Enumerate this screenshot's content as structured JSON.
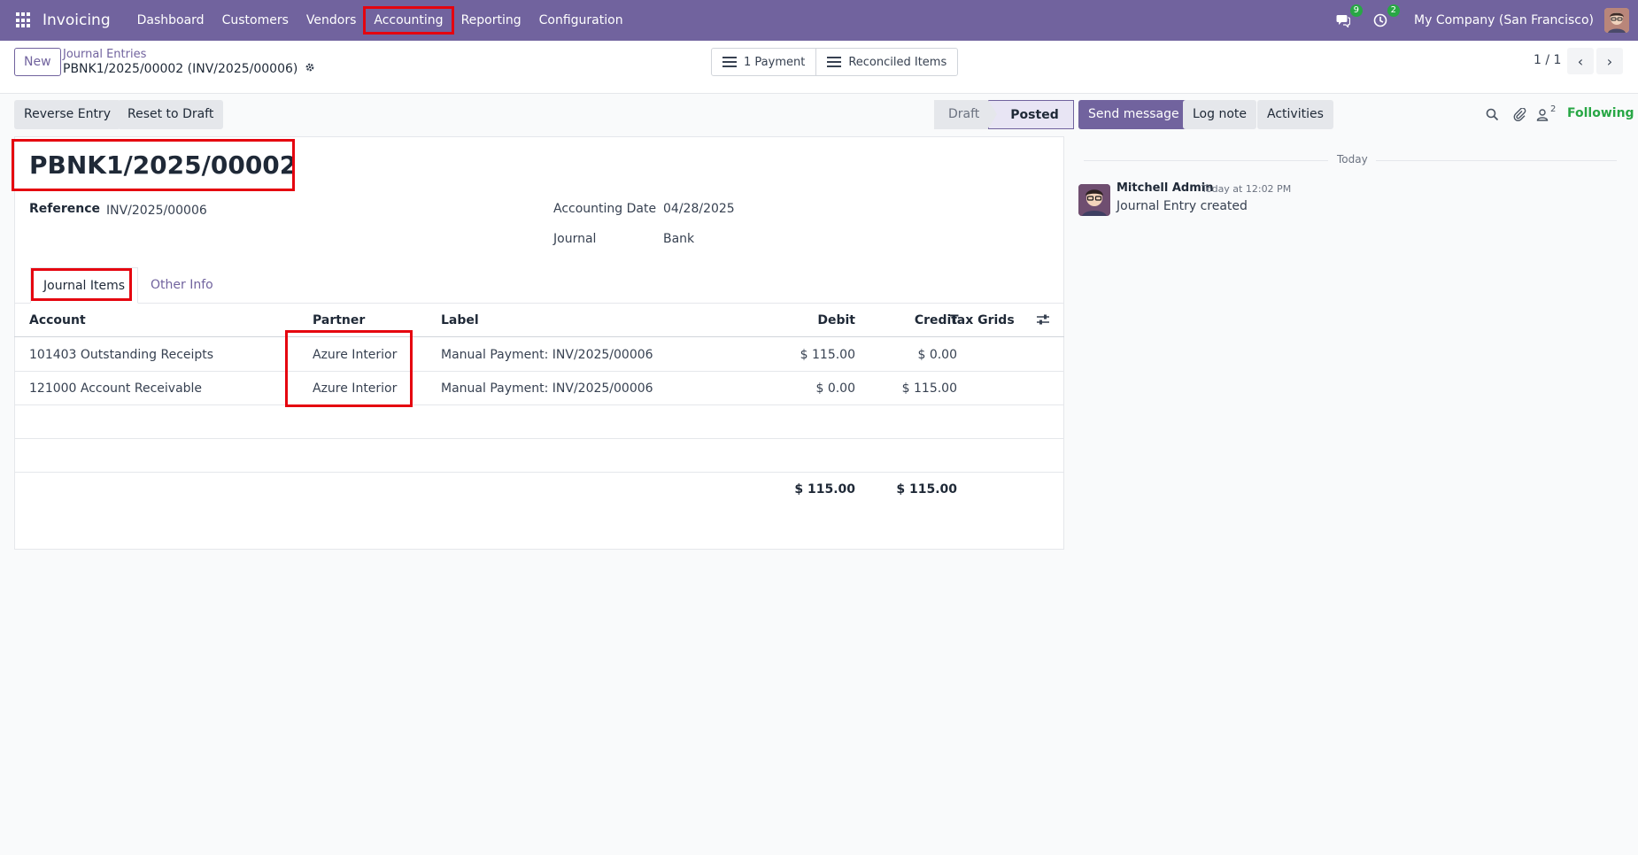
{
  "app": {
    "name": "Invoicing",
    "menu": [
      "Dashboard",
      "Customers",
      "Vendors",
      "Accounting",
      "Reporting",
      "Configuration"
    ],
    "highlighted_menu": "Accounting",
    "messages_badge": "9",
    "activities_badge": "2",
    "company": "My Company (San Francisco)"
  },
  "control_panel": {
    "new_label": "New",
    "breadcrumb_parent": "Journal Entries",
    "breadcrumb_current": "PBNK1/2025/00002 (INV/2025/00006)",
    "smart_buttons": [
      "1 Payment",
      "Reconciled Items"
    ],
    "pager": "1 / 1"
  },
  "actions": {
    "reverse_entry": "Reverse Entry",
    "reset_to_draft": "Reset to Draft",
    "stages": [
      "Draft",
      "Posted"
    ],
    "current_stage": "Posted"
  },
  "form": {
    "title": "PBNK1/2025/00002",
    "reference_label": "Reference",
    "reference_value": "INV/2025/00006",
    "accounting_date_label": "Accounting Date",
    "accounting_date_value": "04/28/2025",
    "journal_label": "Journal",
    "journal_value": "Bank",
    "tabs": [
      "Journal Items",
      "Other Info"
    ],
    "active_tab": "Journal Items"
  },
  "journal_items": {
    "columns": [
      "Account",
      "Partner",
      "Label",
      "Debit",
      "Credit",
      "Tax Grids"
    ],
    "rows": [
      {
        "account": "101403 Outstanding Receipts",
        "partner": "Azure Interior",
        "label": "Manual Payment: INV/2025/00006",
        "debit": "$ 115.00",
        "credit": "$ 0.00",
        "tax_grids": ""
      },
      {
        "account": "121000 Account Receivable",
        "partner": "Azure Interior",
        "label": "Manual Payment: INV/2025/00006",
        "debit": "$ 0.00",
        "credit": "$ 115.00",
        "tax_grids": ""
      }
    ],
    "total_debit": "$ 115.00",
    "total_credit": "$ 115.00"
  },
  "chatter": {
    "send_message": "Send message",
    "log_note": "Log note",
    "activities": "Activities",
    "followers_count": "2",
    "following": "Following",
    "date_separator": "Today",
    "messages": [
      {
        "author": "Mitchell Admin",
        "time": "Today at 12:02 PM",
        "body": "Journal Entry created"
      }
    ]
  },
  "colors": {
    "brand": "#71639e",
    "highlight": "#e5040f",
    "following": "#28a745"
  }
}
